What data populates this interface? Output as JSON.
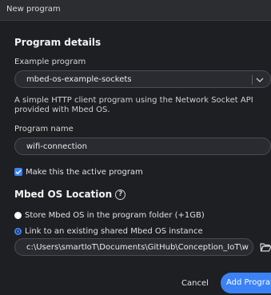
{
  "dialog": {
    "title": "New program"
  },
  "details": {
    "heading": "Program details",
    "example_label": "Example program",
    "example_value": "mbed-os-example-sockets",
    "description": "A simple HTTP client program using the Network Socket API provided with Mbed OS.",
    "name_label": "Program name",
    "name_value": "wifi-connection",
    "active_label": "Make this the active program",
    "active_checked": true
  },
  "location": {
    "heading": "Mbed OS Location",
    "option_store": "Store Mbed OS in the program folder (+1GB)",
    "option_link": "Link to an existing shared Mbed OS instance",
    "selected": "link",
    "path_value": "c:\\Users\\smartIoT\\Documents\\GitHub\\Conception_IoT\\w"
  },
  "actions": {
    "cancel_label": "Cancel",
    "add_label": "Add Program"
  },
  "colors": {
    "accent": "#3b82f6",
    "background": "#1e1f22"
  }
}
